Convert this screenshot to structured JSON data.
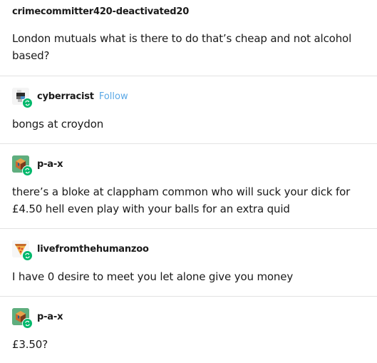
{
  "posts": [
    {
      "username": "crimecommitter420-deactivated20",
      "text": "London mutuals what is there to do that’s cheap and not alcohol based?"
    },
    {
      "username": "cyberracist",
      "follow_label": "Follow",
      "avatar_icon": "pixel-art-avatar",
      "text": "bongs at croydon"
    },
    {
      "username": "p-a-x",
      "avatar_icon": "cube-avatar",
      "text": "there’s a bloke at clappham common who will suck your dick for £4.50 hell even play with your balls for an extra quid"
    },
    {
      "username": "livefromthehumanzoo",
      "avatar_icon": "pizza-slice-avatar",
      "text": "I have 0 desire to meet you let alone give you money"
    },
    {
      "username": "p-a-x",
      "avatar_icon": "cube-avatar",
      "text": "£3.50?"
    }
  ],
  "colors": {
    "follow_link": "#5aa8e6",
    "reblog_badge": "#00b86b",
    "divider": "#e3e3e3"
  }
}
